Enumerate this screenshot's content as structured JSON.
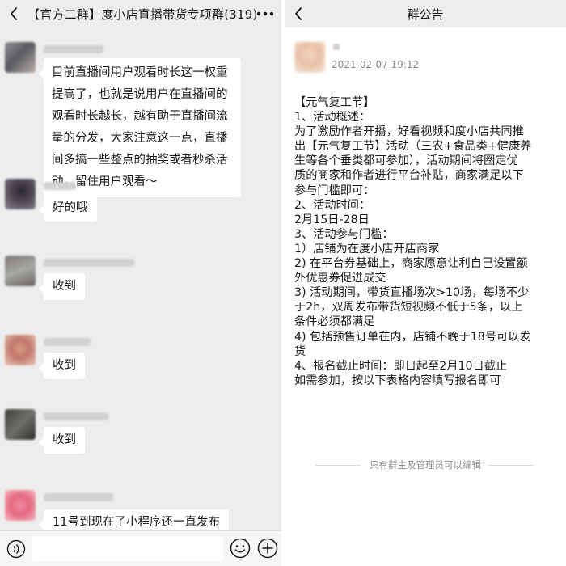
{
  "chat": {
    "title": "【官方二群】度小店直播带货专项群(319)",
    "messages": [
      {
        "lines": [
          "目前直播间用户观看时长这一权重",
          "提高了，也就是说用户在直播间的",
          "观看时长越长，越有助于直播间流",
          "量的分发，大家注意这一点，直播",
          "间多搞一些整点的抽奖或者秒杀活",
          "动，留住用户观看～"
        ]
      },
      {
        "lines": [
          "好的哦"
        ]
      },
      {
        "lines": [
          "收到"
        ]
      },
      {
        "lines": [
          "收到"
        ]
      },
      {
        "lines": [
          "收到"
        ]
      },
      {
        "lines": [
          "11号到现在了小程序还一直发布"
        ]
      }
    ]
  },
  "notice": {
    "title": "群公告",
    "time": "2021-02-07 19:12",
    "body": [
      "【元气复工节】",
      "1、活动概述：",
      "为了激励作者开播，好看视频和度小店共同推",
      "出【元气复工节】活动（三农+食品类+健康养",
      "生等各个垂类都可参加），活动期间将圈定优",
      "质的商家和作者进行平台补贴，商家满足以下",
      "参与门槛即可：",
      "2、活动时间：",
      "2月15日-28日",
      "3、活动参与门槛：",
      "1）店铺为在度小店开店商家",
      "2) 在平台券基础上，商家愿意让利自己设置额",
      "外优惠券促进成交",
      "3) 活动期间，带货直播场次>10场，每场不少",
      "于2h，双周发布带货短视频不低于5条，以上",
      "条件必须都满足",
      "4) 包括预售订单在内，店铺不晚于18号可以发",
      "货",
      "4、报名截止时间：即日起至2月10日截止",
      "如需参加，按以下表格内容填写报名即可"
    ],
    "footer": "只有群主及管理员可以编辑"
  },
  "icons": {
    "back": "chevron-left-icon",
    "more": "more-dots-icon",
    "voice": "voice-icon",
    "emoji": "emoji-icon",
    "plus": "plus-icon"
  },
  "colors": {
    "chat_background": "#ededed",
    "bubble": "#ffffff",
    "text": "#191919",
    "muted_text": "#8a8a8a"
  }
}
